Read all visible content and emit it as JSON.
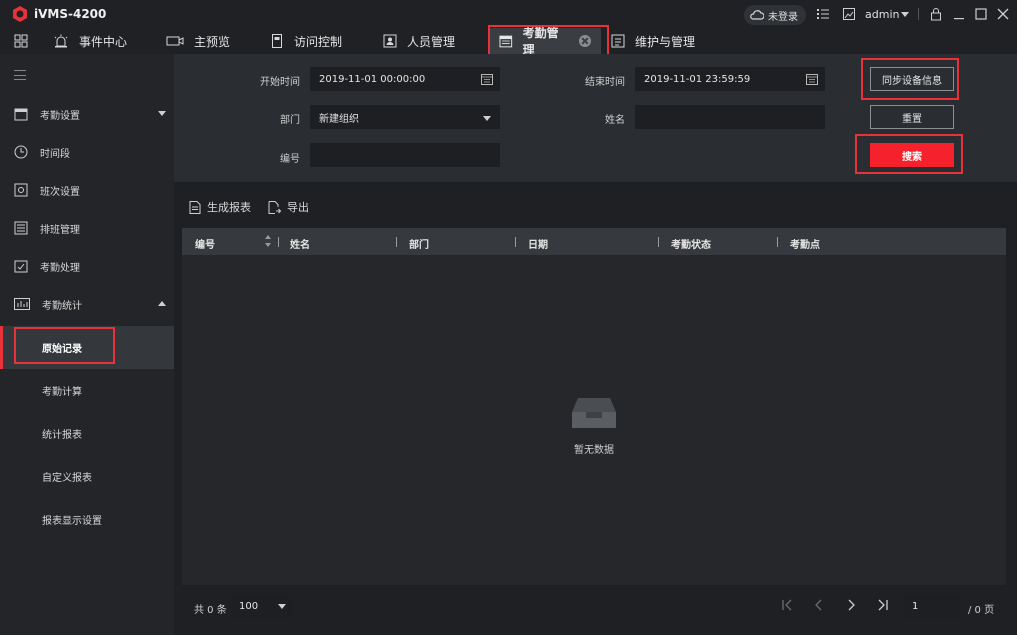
{
  "app": {
    "title": "iVMS-4200"
  },
  "titlebar": {
    "login_status": "未登录",
    "user": "admin"
  },
  "nav": {
    "tabs": [
      {
        "label": "事件中心"
      },
      {
        "label": "主预览"
      },
      {
        "label": "访问控制"
      },
      {
        "label": "人员管理"
      },
      {
        "label": "考勤管理"
      },
      {
        "label": "维护与管理"
      }
    ]
  },
  "sidebar": {
    "items": [
      {
        "label": "考勤设置"
      },
      {
        "label": "时间段"
      },
      {
        "label": "班次设置"
      },
      {
        "label": "排班管理"
      },
      {
        "label": "考勤处理"
      },
      {
        "label": "考勤统计"
      }
    ],
    "subitems": [
      {
        "label": "原始记录"
      },
      {
        "label": "考勤计算"
      },
      {
        "label": "统计报表"
      },
      {
        "label": "自定义报表"
      },
      {
        "label": "报表显示设置"
      }
    ]
  },
  "filter": {
    "start_label": "开始时间",
    "start_value": "2019-11-01 00:00:00",
    "end_label": "结束时间",
    "end_value": "2019-11-01 23:59:59",
    "dept_label": "部门",
    "dept_value": "新建组织",
    "name_label": "姓名",
    "name_value": "",
    "id_label": "编号",
    "id_value": "",
    "sync_button": "同步设备信息",
    "reset_button": "重置",
    "search_button": "搜索"
  },
  "toolbar": {
    "report_label": "生成报表",
    "export_label": "导出"
  },
  "table": {
    "columns": [
      "编号",
      "姓名",
      "部门",
      "日期",
      "考勤状态",
      "考勤点"
    ],
    "empty_text": "暂无数据"
  },
  "footer": {
    "total_text": "共 0 条",
    "page_size": "100",
    "current_page": "1",
    "total_pages": "/ 0 页"
  },
  "colors": {
    "accent": "#f5222d",
    "highlight": "#e8323a",
    "background": "#1e2023"
  }
}
